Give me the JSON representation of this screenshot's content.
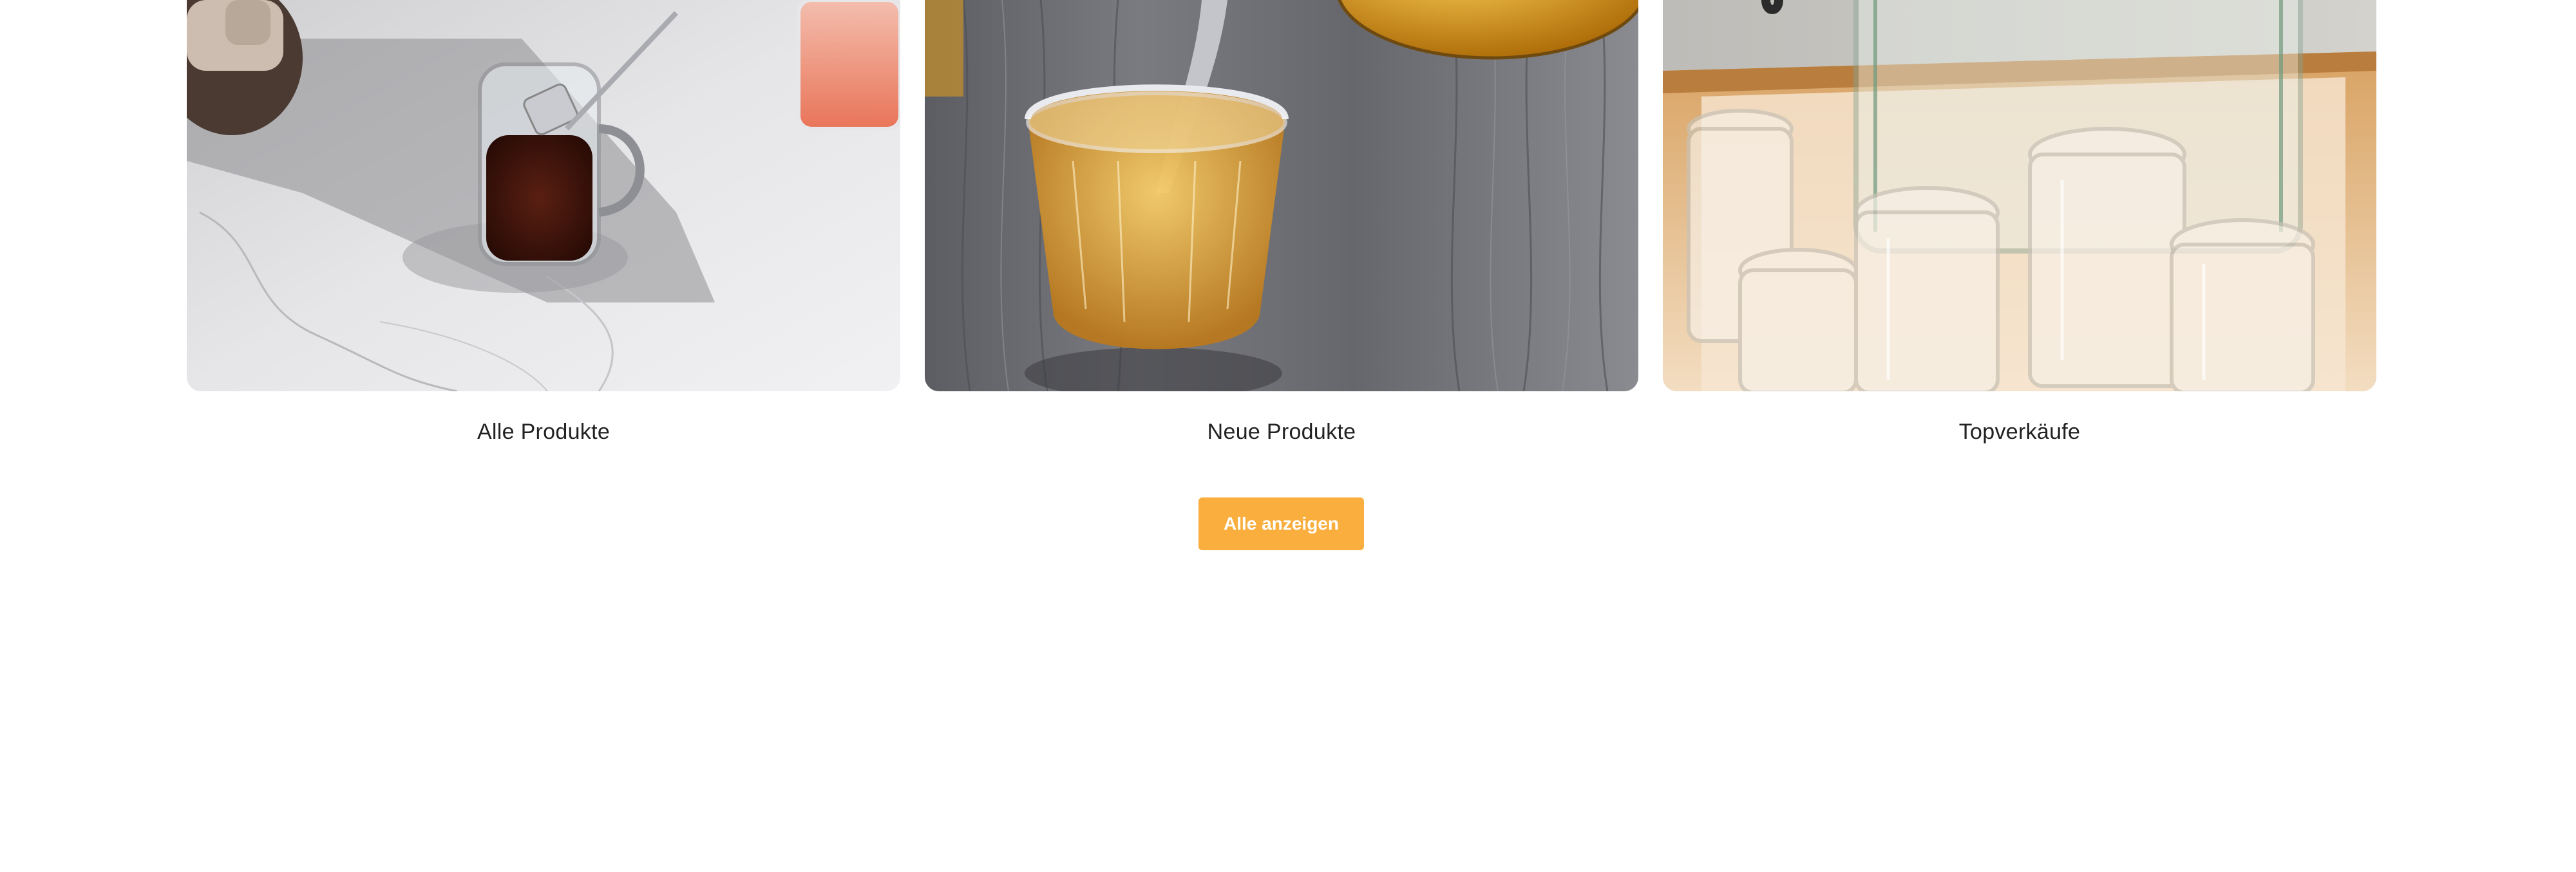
{
  "collections": [
    {
      "title": "Alle Produkte",
      "image_alt": "iced-coffee-glass-image"
    },
    {
      "title": "Neue Produkte",
      "image_alt": "tea-pouring-cup-image"
    },
    {
      "title": "Topverkäufe",
      "image_alt": "glass-cups-tray-image"
    }
  ],
  "view_all": {
    "label": "Alle anzeigen"
  },
  "colors": {
    "accent": "#F9AE3E",
    "text": "#222222",
    "background": "#FFFFFF"
  }
}
